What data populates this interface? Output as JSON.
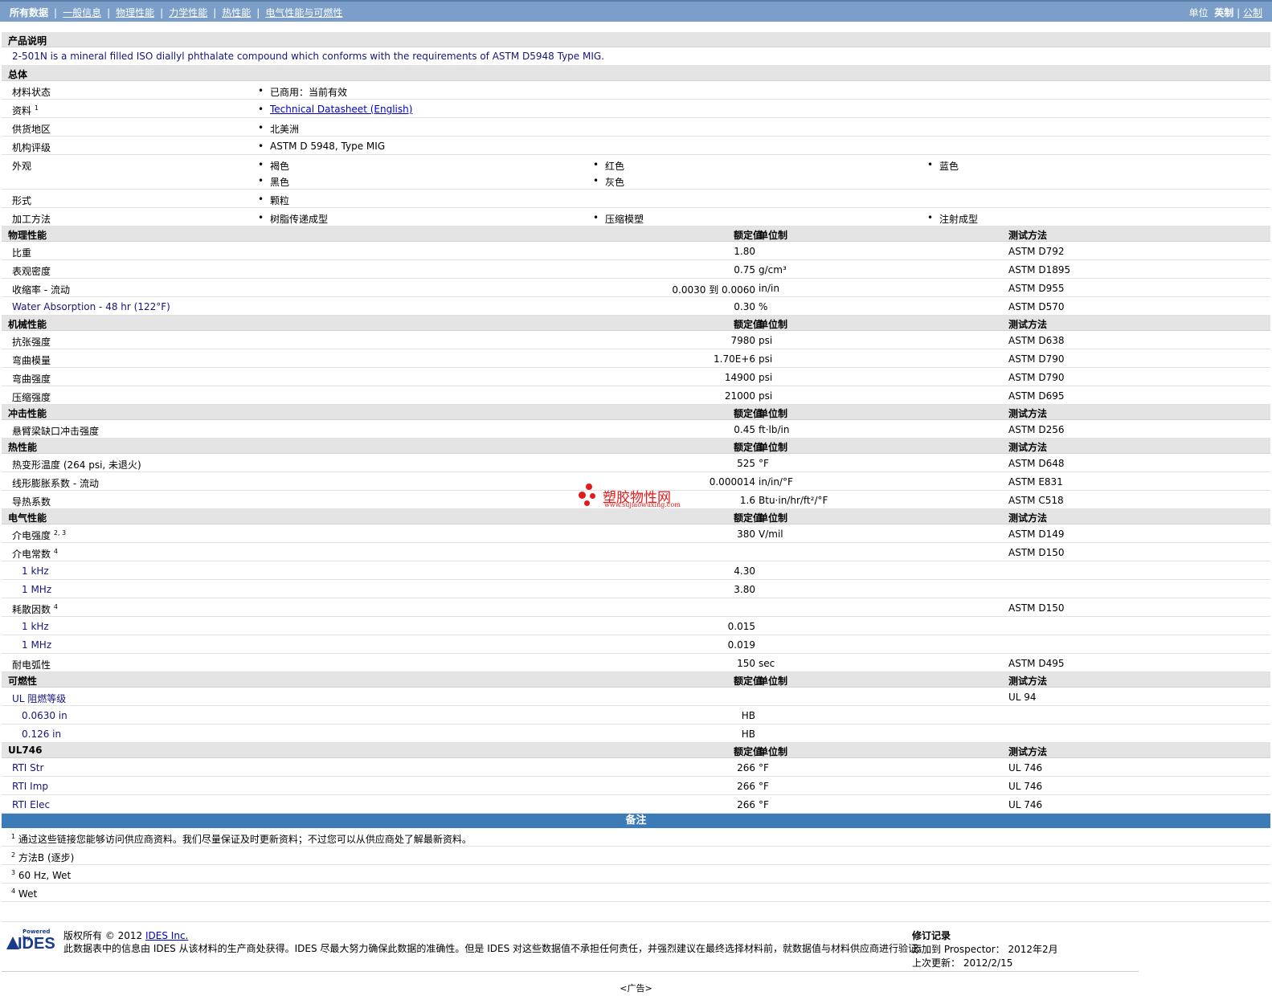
{
  "nav": {
    "tabs": [
      "所有数据",
      "一般信息",
      "物理性能",
      "力学性能",
      "热性能",
      "电气性能与可燃性"
    ],
    "units_label": "单位",
    "units_current": "英制",
    "units_other": "公制"
  },
  "product": {
    "header": "产品说明",
    "description": "2-501N is a mineral filled ISO diallyl phthalate compound which conforms with the requirements of ASTM D5948 Type MIG."
  },
  "general": {
    "header": "总体",
    "status_label": "材料状态",
    "status_value": "已商用：当前有效",
    "docs_label": "资料",
    "docs_sup": "1",
    "docs_link": "Technical Datasheet (English)",
    "region_label": "供货地区",
    "region_value": "北美洲",
    "agency_label": "机构评级",
    "agency_value": "ASTM D 5948, Type MIG",
    "appearance_label": "外观",
    "appearance": [
      "褐色",
      "红色",
      "蓝色",
      "黑色",
      "灰色"
    ],
    "form_label": "形式",
    "form_value": "颗粒",
    "process_label": "加工方法",
    "process": [
      "树脂传递成型",
      "压缩模塑",
      "注射成型"
    ]
  },
  "cols": {
    "value": "额定值",
    "unit": "单位制",
    "test": "测试方法"
  },
  "physical": {
    "header": "物理性能",
    "rows": [
      {
        "label": "比重",
        "value": "1.80",
        "unit": "",
        "test": "ASTM D792"
      },
      {
        "label": "表观密度",
        "value": "0.75",
        "unit": "g/cm³",
        "test": "ASTM D1895"
      },
      {
        "label": "收缩率 - 流动",
        "value": "0.0030 到 0.0060",
        "unit": "in/in",
        "test": "ASTM D955"
      },
      {
        "label": "Water Absorption - 48 hr (122°F)",
        "value": "0.30",
        "unit": "%",
        "test": "ASTM D570"
      }
    ]
  },
  "mechanical": {
    "header": "机械性能",
    "rows": [
      {
        "label": "抗张强度",
        "value": "7980",
        "unit": "psi",
        "test": "ASTM D638"
      },
      {
        "label": "弯曲模量",
        "value": "1.70E+6",
        "unit": "psi",
        "test": "ASTM D790"
      },
      {
        "label": "弯曲强度",
        "value": "14900",
        "unit": "psi",
        "test": "ASTM D790"
      },
      {
        "label": "压缩强度",
        "value": "21000",
        "unit": "psi",
        "test": "ASTM D695"
      }
    ]
  },
  "impact": {
    "header": "冲击性能",
    "rows": [
      {
        "label": "悬臂梁缺口冲击强度",
        "value": "0.45",
        "unit": "ft·lb/in",
        "test": "ASTM D256"
      }
    ]
  },
  "thermal": {
    "header": "热性能",
    "rows": [
      {
        "label": "热变形温度 (264 psi, 未退火)",
        "value": "525",
        "unit": "°F",
        "test": "ASTM D648"
      },
      {
        "label": "线形膨胀系数 - 流动",
        "value": "0.000014",
        "unit": "in/in/°F",
        "test": "ASTM E831"
      },
      {
        "label": "导热系数",
        "value": "1.6",
        "unit": "Btu·in/hr/ft²/°F",
        "test": "ASTM C518"
      }
    ]
  },
  "electrical": {
    "header": "电气性能",
    "dielectric_strength": {
      "label": "介电强度",
      "sup": "2, 3",
      "value": "380",
      "unit": "V/mil",
      "test": "ASTM D149"
    },
    "dielectric_constant": {
      "label": "介电常数",
      "sup": "4",
      "test": "ASTM D150",
      "sub": [
        {
          "label": "1 kHz",
          "value": "4.30"
        },
        {
          "label": "1 MHz",
          "value": "3.80"
        }
      ]
    },
    "dissipation": {
      "label": "耗散因数",
      "sup": "4",
      "test": "ASTM D150",
      "sub": [
        {
          "label": "1 kHz",
          "value": "0.015"
        },
        {
          "label": "1 MHz",
          "value": "0.019"
        }
      ]
    },
    "arc": {
      "label": "耐电弧性",
      "value": "150",
      "unit": "sec",
      "test": "ASTM D495"
    }
  },
  "flammability": {
    "header": "可燃性",
    "ul": {
      "label": "UL 阻燃等级",
      "test": "UL 94",
      "sub": [
        {
          "label": "0.0630 in",
          "value": "HB"
        },
        {
          "label": "0.126 in",
          "value": "HB"
        }
      ]
    }
  },
  "ul746": {
    "header": "UL746",
    "rows": [
      {
        "label": "RTI Str",
        "value": "266",
        "unit": "°F",
        "test": "UL 746"
      },
      {
        "label": "RTI Imp",
        "value": "266",
        "unit": "°F",
        "test": "UL 746"
      },
      {
        "label": "RTI Elec",
        "value": "266",
        "unit": "°F",
        "test": "UL 746"
      }
    ]
  },
  "notes": {
    "header": "备注",
    "items": [
      {
        "n": "1",
        "text": "通过这些链接您能够访问供应商资料。我们尽量保证及时更新资料；不过您可以从供应商处了解最新资料。"
      },
      {
        "n": "2",
        "text": "方法B (逐步)"
      },
      {
        "n": "3",
        "text": "60 Hz, Wet"
      },
      {
        "n": "4",
        "text": "Wet"
      }
    ]
  },
  "footer": {
    "logo_small": "Powered by",
    "logo_big": "IDES",
    "copyright_prefix": "版权所有 © 2012",
    "copyright_link": "IDES Inc.",
    "disclaimer": "此数据表中的信息由 IDES 从该材料的生产商处获得。IDES 尽最大努力确保此数据的准确性。但是 IDES 对这些数据值不承担任何责任，并强烈建议在最终选择材料前，就数据值与材料供应商进行验证。",
    "rev_title": "修订记录",
    "rev_added": "添加到 Prospector： 2012年2月",
    "rev_updated": "上次更新： 2012/2/15",
    "ad": "<广告>"
  },
  "watermark": {
    "title": "塑胶物性网",
    "url": "www.sujiaowuxing.com"
  }
}
